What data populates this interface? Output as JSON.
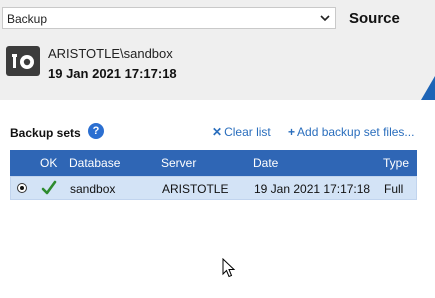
{
  "source": {
    "select_value": "Backup",
    "title": "Source",
    "server_name": "ARISTOTLE\\sandbox",
    "timestamp": "19 Jan 2021 17:17:18",
    "accent_color": "#1d64b6"
  },
  "backup_sets": {
    "label": "Backup sets",
    "help_icon_glyph": "?",
    "clear_label": "Clear list",
    "add_label": "Add backup set files...",
    "clear_icon": "x-icon",
    "add_icon": "plus-icon",
    "columns": {
      "ok": "OK",
      "database": "Database",
      "server": "Server",
      "date": "Date",
      "type": "Type"
    },
    "rows": [
      {
        "selected": true,
        "ok": true,
        "database": "sandbox",
        "server": "ARISTOTLE",
        "date": "19 Jan 2021 17:17:18",
        "type": "Full"
      }
    ],
    "header_color": "#2f66b5",
    "row_selected_color": "#d3e3f6"
  }
}
